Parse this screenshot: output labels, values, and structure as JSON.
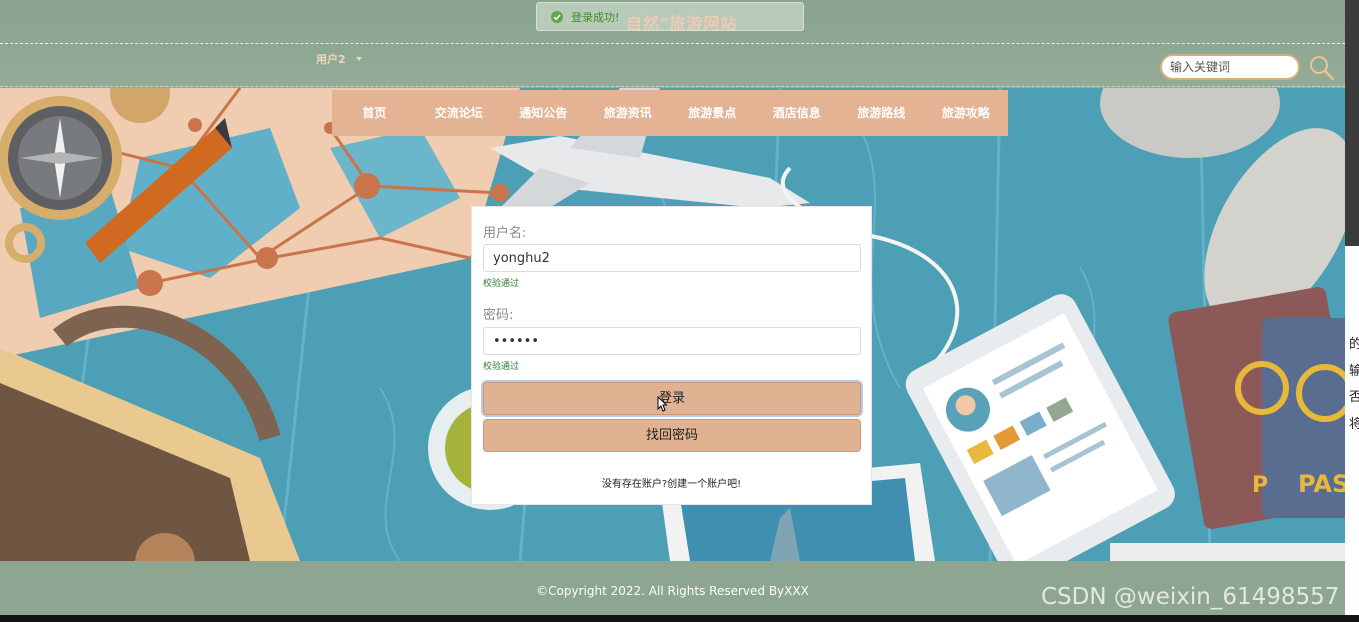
{
  "header": {
    "site_title": "自然\"旅游网站",
    "user_label": "用户2",
    "search_placeholder": "输入关键词"
  },
  "toast": {
    "message": "登录成功!"
  },
  "nav": {
    "items": [
      "首页",
      "交流论坛",
      "通知公告",
      "旅游资讯",
      "旅游景点",
      "酒店信息",
      "旅游路线",
      "旅游攻略"
    ]
  },
  "login": {
    "username_label": "用户名:",
    "username_value": "yonghu2",
    "username_status": "校验通过",
    "password_label": "密码:",
    "password_value": "••••••",
    "password_status": "校验通过",
    "login_button": "登录",
    "find_password_button": "找回密码",
    "register_link": "没有存在账户?创建一个账户吧!"
  },
  "footer": {
    "copyright": "©Copyright 2022. All Rights Reserved ByXXX"
  },
  "side_text": [
    "的",
    "输",
    "否",
    "将"
  ],
  "watermark": "CSDN @weixin_61498557",
  "colors": {
    "nav_bg": "#e4b393",
    "header_bg": "#8fa795",
    "button_bg": "#e0b292",
    "success": "#2f7d32"
  }
}
